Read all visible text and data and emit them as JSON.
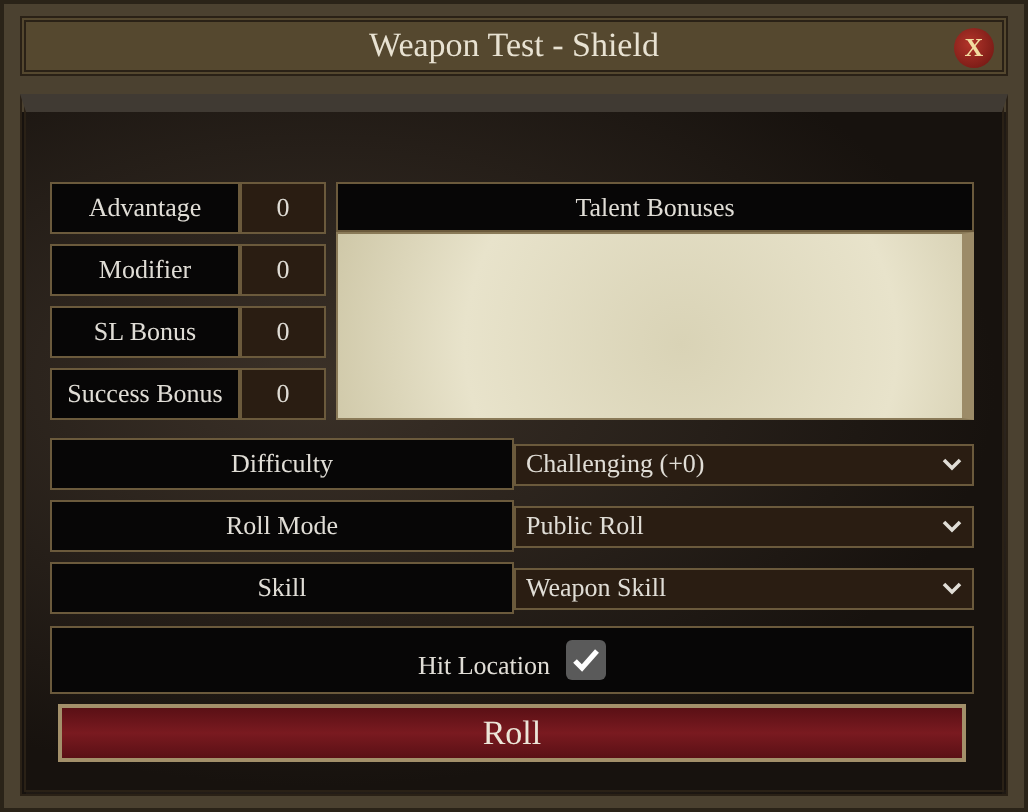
{
  "window": {
    "title": "Weapon Test - Shield",
    "close": "X"
  },
  "modifiers": [
    {
      "label": "Advantage",
      "value": "0"
    },
    {
      "label": "Modifier",
      "value": "0"
    },
    {
      "label": "SL Bonus",
      "value": "0"
    },
    {
      "label": "Success Bonus",
      "value": "0"
    }
  ],
  "talent_bonuses": {
    "title": "Talent Bonuses"
  },
  "selects": [
    {
      "label": "Difficulty",
      "value": "Challenging (+0)"
    },
    {
      "label": "Roll Mode",
      "value": "Public Roll"
    },
    {
      "label": "Skill",
      "value": "Weapon Skill"
    }
  ],
  "hit_location": {
    "label": "Hit Location",
    "checked": true
  },
  "roll_button": "Roll"
}
